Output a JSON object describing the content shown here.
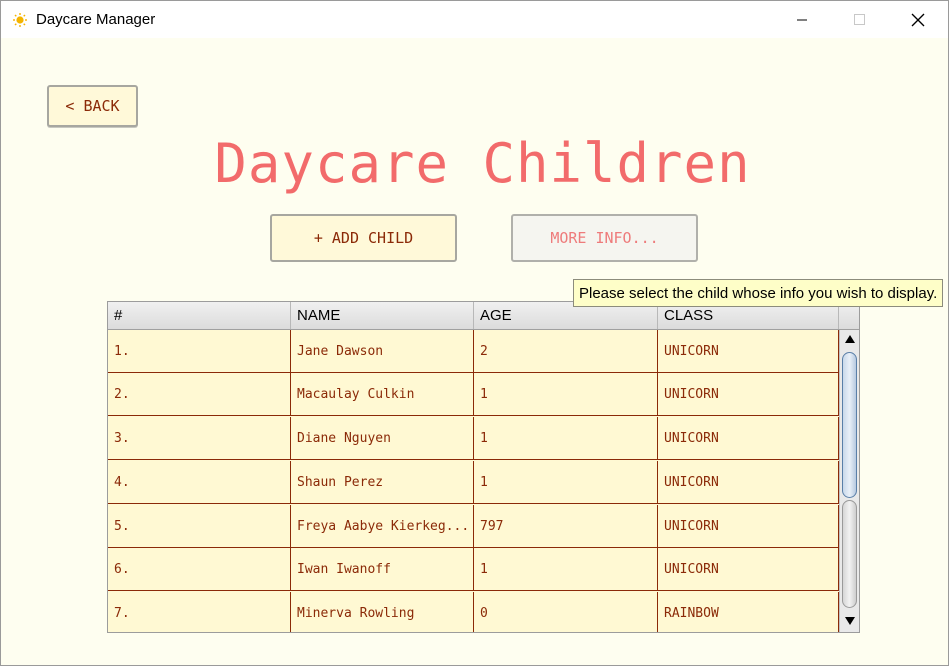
{
  "window": {
    "title": "Daycare Manager",
    "icon": "sun-icon",
    "controls": {
      "minimize_icon": "minimize-icon",
      "maximize_icon": "maximize-icon",
      "close_icon": "close-icon"
    }
  },
  "toolbar": {
    "back_label": "< BACK",
    "add_child_label": "+ ADD CHILD",
    "more_info_label": "MORE INFO..."
  },
  "page": {
    "title": "Daycare Children"
  },
  "tooltip": {
    "text": "Please select the child whose info you wish to display."
  },
  "table": {
    "columns": [
      "#",
      "NAME",
      "AGE",
      "CLASS"
    ],
    "rows": [
      {
        "num": "1.",
        "name": "Jane Dawson",
        "age": "2",
        "class": "UNICORN"
      },
      {
        "num": "2.",
        "name": "Macaulay Culkin",
        "age": "1",
        "class": "UNICORN"
      },
      {
        "num": "3.",
        "name": "Diane Nguyen",
        "age": "1",
        "class": "UNICORN"
      },
      {
        "num": "4.",
        "name": "Shaun Perez",
        "age": "1",
        "class": "UNICORN"
      },
      {
        "num": "5.",
        "name": "Freya Aabye Kierkeg...",
        "age": "797",
        "class": "UNICORN"
      },
      {
        "num": "6.",
        "name": "Iwan Iwanoff",
        "age": "1",
        "class": "UNICORN"
      },
      {
        "num": "7.",
        "name": "Minerva Rowling",
        "age": "0",
        "class": "RAINBOW"
      }
    ]
  },
  "colors": {
    "title": "#f26b6b",
    "text": "#8b2a08",
    "button_bg": "#fff9d9",
    "row_bg": "#fff9d3",
    "page_bg": "#fefef0",
    "tooltip_bg": "#fefec8"
  }
}
